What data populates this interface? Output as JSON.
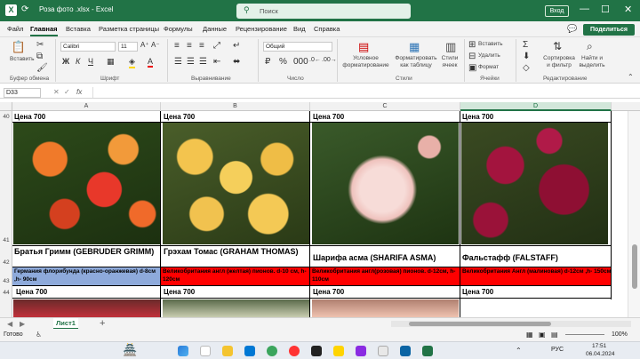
{
  "titlebar": {
    "filename": "Роза фото .xlsx  -  Excel",
    "search_placeholder": "Поиск",
    "sign_in": "Вход",
    "min": "—",
    "max": "☐",
    "close": "✕"
  },
  "menu": {
    "items": [
      "Файл",
      "Главная",
      "Вставка",
      "Разметка страницы",
      "Формулы",
      "Данные",
      "Рецензирование",
      "Вид",
      "Справка"
    ],
    "share": "Поделиться"
  },
  "ribbon": {
    "paste": "Вставить",
    "clipboard_group": "Буфер обмена",
    "font_name": "Calibri",
    "font_size": "11",
    "font_group": "Шрифт",
    "align_group": "Выравнивание",
    "number_format": "Общий",
    "number_group": "Число",
    "cond_format": "Условное форматирование",
    "format_table": "Форматировать как таблицу",
    "cell_styles": "Стили ячеек",
    "styles_group": "Стили",
    "insert": "Вставить",
    "delete": "Удалить",
    "format": "Формат",
    "cells_group": "Ячейки",
    "sort_filter": "Сортировка и фильтр",
    "find_select": "Найти и выделить",
    "edit_group": "Редактирование"
  },
  "formula_bar": {
    "name_box": "D33",
    "fx": "fx",
    "value": ""
  },
  "columns": [
    "A",
    "B",
    "C",
    "D"
  ],
  "rows": [
    "40",
    "41",
    "42",
    "43",
    "44"
  ],
  "cells": {
    "price": [
      "Цена 700",
      "Цена 700",
      "Цена 700",
      "Цена 700"
    ],
    "names": [
      "Братья Гримм (GEBRUDER GRIMM)",
      "Грэхам Томас (GRAHAM THOMAS)",
      "Шарифа асма (SHARIFA ASMA)",
      "Фальстафф (FALSTAFF)"
    ],
    "descriptions": [
      "Германия флорибунда (красно-оранжевая) d-8см ,h- 90см",
      "Великобритания англ (желтая) пионов. d-10 см, h-120см",
      "Великобритания англ(розовая) пионов. d-12см, h- 110см",
      "Великобритания Англ (малиновая) d-12см ,h- 150см"
    ],
    "price2": [
      "Цена 700",
      "Цена 700",
      "Цена 700",
      "Цена 700"
    ]
  },
  "colors": {
    "excel_green": "#217346",
    "desc_a": "#8eaadb",
    "desc_red": "#ff0000"
  },
  "sheet": {
    "tab": "Лист1",
    "add": "+"
  },
  "status": {
    "ready": "Готово",
    "zoom": "100%"
  },
  "taskbar": {
    "lang": "РУС",
    "time": "17:51",
    "date": "06.04.2024"
  }
}
